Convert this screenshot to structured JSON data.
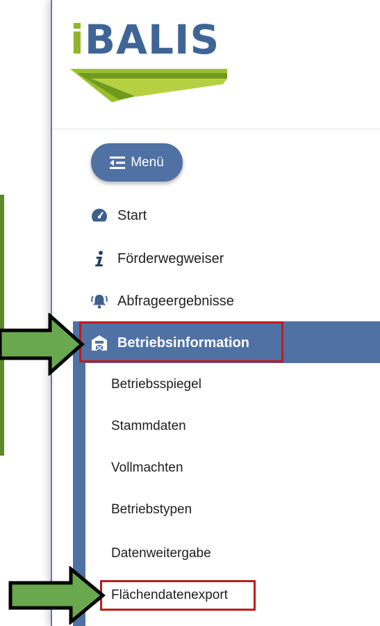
{
  "logo": {
    "text_i": "i",
    "text_rest": "BALIS"
  },
  "menu_button": {
    "label": "Menü",
    "icon": "menu-collapse-icon"
  },
  "nav": [
    {
      "label": "Start",
      "icon": "speedometer-icon"
    },
    {
      "label": "Förderwegweiser",
      "icon": "info-icon"
    },
    {
      "label": "Abfrageergebnisse",
      "icon": "bell-icon"
    }
  ],
  "active_section": {
    "label": "Betriebsinformation",
    "icon": "farm-barn-icon"
  },
  "submenu": [
    {
      "label": "Betriebsspiegel"
    },
    {
      "label": "Stammdaten"
    },
    {
      "label": "Vollmachten"
    },
    {
      "label": "Betriebstypen"
    },
    {
      "label": "Datenweitergabe"
    },
    {
      "label": "Flächendatenexport"
    }
  ],
  "colors": {
    "primary_blue": "#4f71a4",
    "logo_blue": "#3f6597",
    "logo_green": "#8fb52a",
    "highlight_red": "#c01a1a",
    "arrow_green": "#6aa84f"
  }
}
